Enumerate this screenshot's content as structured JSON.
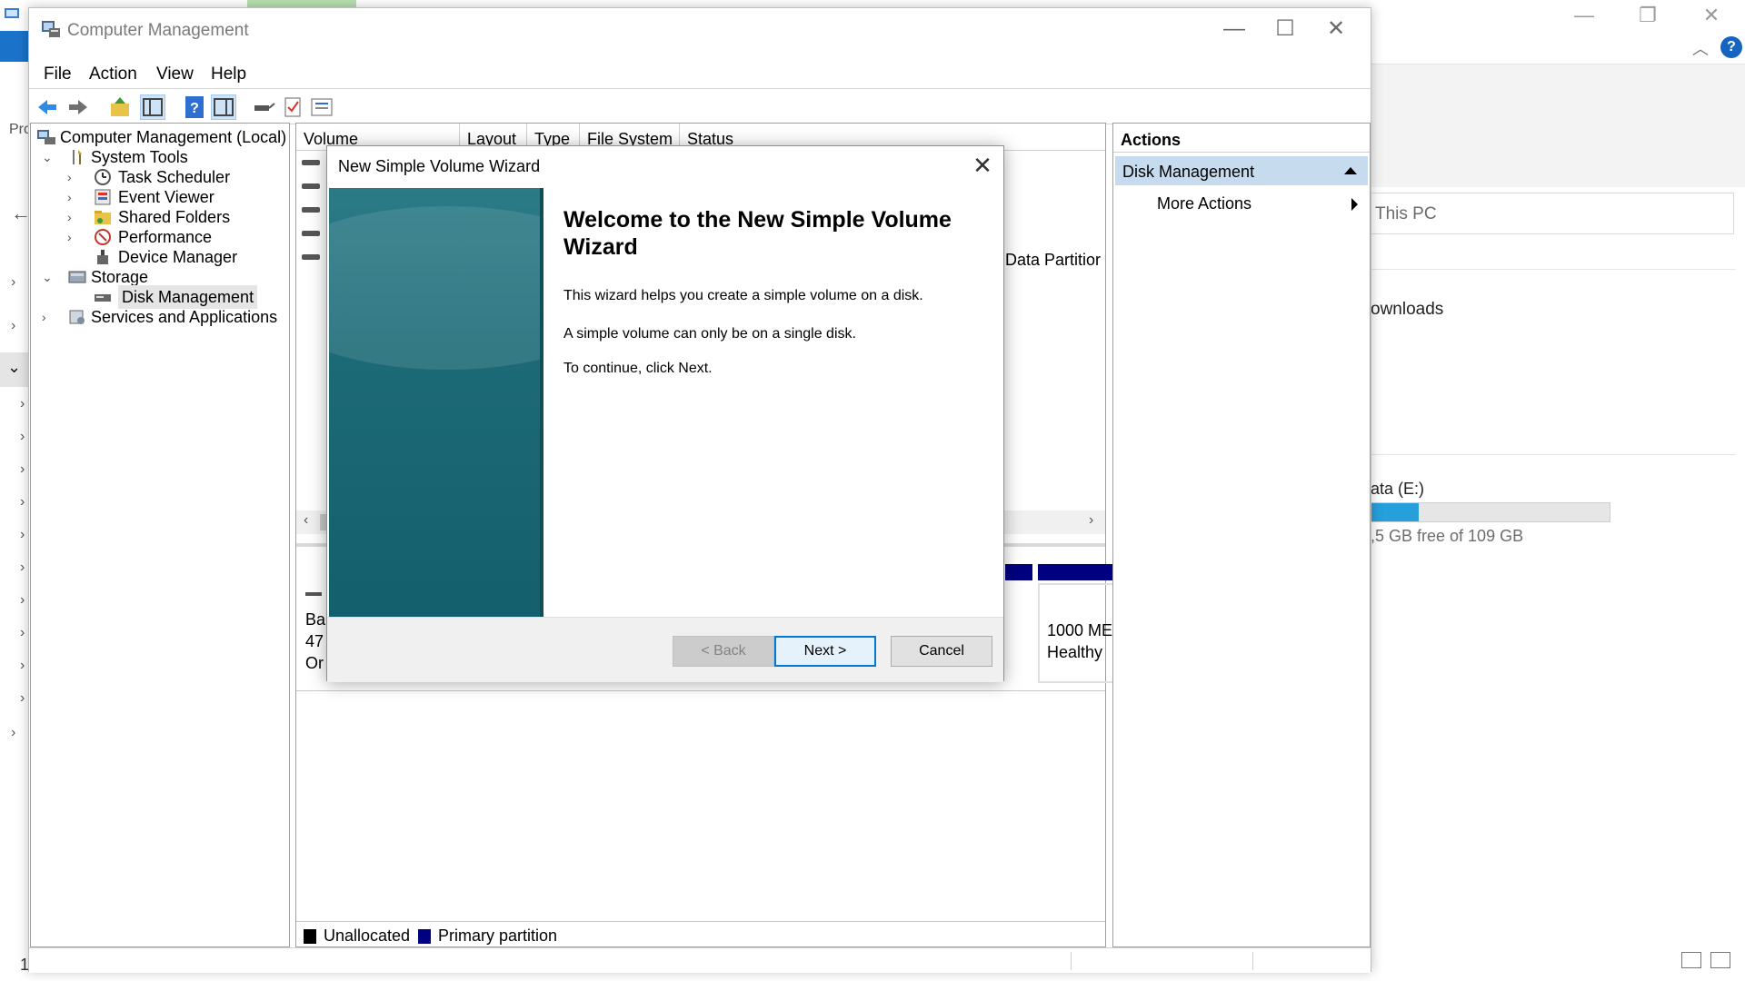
{
  "background": {
    "address_bar_text": "This PC",
    "downloads_label": "ownloads",
    "drive_label": "ata (E:)",
    "drive_free_text": ",5 GB free of 109 GB",
    "drive_used_fraction": 0.2,
    "left_strip_text": "Pro",
    "bottom_left_text": "1",
    "accent_color": "#1a73c8"
  },
  "window": {
    "title": "Computer Management",
    "controls": {
      "minimize": "—",
      "maximize": "☐",
      "close": "✕"
    }
  },
  "menu": {
    "file": "File",
    "action": "Action",
    "view": "View",
    "help": "Help"
  },
  "toolbar": {
    "icons": [
      "back-arrow-icon",
      "forward-arrow-icon",
      "up-folder-icon",
      "show-hide-console-tree-icon",
      "help-icon",
      "show-hide-action-pane-icon",
      "connect-icon",
      "checklist-icon",
      "properties-icon"
    ]
  },
  "tree": {
    "root": "Computer Management (Local)",
    "system_tools": "System Tools",
    "task_scheduler": "Task Scheduler",
    "event_viewer": "Event Viewer",
    "shared_folders": "Shared Folders",
    "performance": "Performance",
    "device_manager": "Device Manager",
    "storage": "Storage",
    "disk_management": "Disk Management",
    "services_apps": "Services and Applications"
  },
  "volume_list": {
    "columns": [
      "Volume",
      "Layout",
      "Type",
      "File System",
      "Status"
    ],
    "visible_status_fragment": "Data Partitior"
  },
  "disk_map": {
    "left_lines": [
      "Ba",
      "47",
      "Or"
    ],
    "partition_size": "1000 ME",
    "partition_status": "Healthy"
  },
  "legend": {
    "unallocated": "Unallocated",
    "primary": "Primary partition",
    "unallocated_color": "#000000",
    "primary_color": "#000080"
  },
  "actions": {
    "header": "Actions",
    "section": "Disk Management",
    "more": "More Actions"
  },
  "wizard": {
    "title": "New Simple Volume Wizard",
    "close": "✕",
    "heading": "Welcome to the New Simple Volume Wizard",
    "para1": "This wizard helps you create a simple volume on a disk.",
    "para2": "A simple volume can only be on a single disk.",
    "para3": "To continue, click Next.",
    "back_label": "< Back",
    "next_label": "Next >",
    "cancel_label": "Cancel"
  }
}
